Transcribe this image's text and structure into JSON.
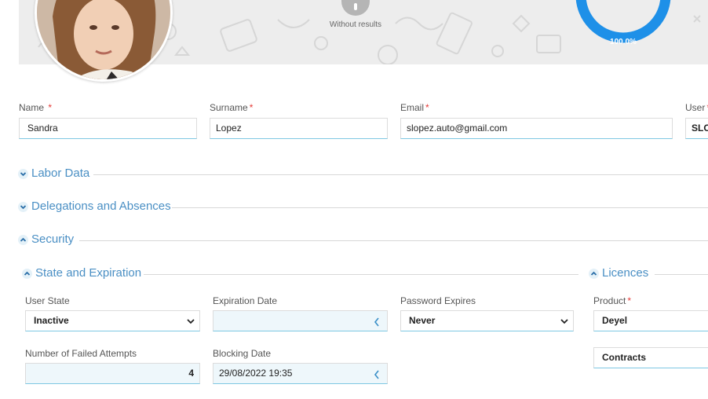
{
  "header": {
    "no_results_label": "Without results",
    "progress_value": 100.0,
    "progress_label": "100.0%",
    "accent_color": "#1e90e8"
  },
  "fields": {
    "name_label": "Name",
    "name_value": "Sandra",
    "surname_label": "Surname",
    "surname_value": "Lopez",
    "email_label": "Email",
    "email_value": "slopez.auto@gmail.com",
    "user_label": "User",
    "user_value": "SLOPEZ"
  },
  "sections": {
    "labor_data": "Labor Data",
    "delegations": "Delegations and Absences",
    "security": "Security",
    "state_expiration": "State and Expiration",
    "licences": "Licences"
  },
  "security": {
    "user_state_label": "User State",
    "user_state_value": "Inactive",
    "expiration_date_label": "Expiration Date",
    "expiration_date_value": "",
    "password_expires_label": "Password Expires",
    "password_expires_value": "Never",
    "failed_attempts_label": "Number of Failed Attempts",
    "failed_attempts_value": "4",
    "blocking_date_label": "Blocking Date",
    "blocking_date_value": "29/08/2022 19:35"
  },
  "licences": {
    "product_label": "Product",
    "product_value": "Deyel",
    "product_value_2": "Contracts"
  }
}
